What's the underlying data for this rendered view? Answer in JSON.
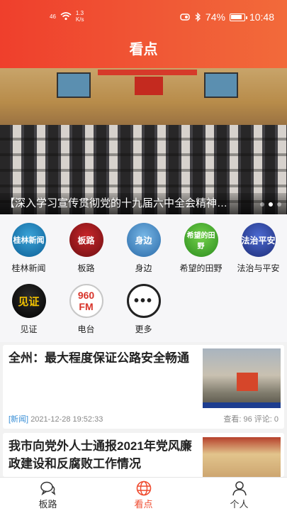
{
  "status_bar": {
    "signal": "46",
    "speed_value": "1.3",
    "speed_unit": "K/s",
    "battery": "74%",
    "time": "10:48"
  },
  "header": {
    "title": "看点"
  },
  "banner": {
    "caption": "【深入学习宣传贯彻党的十九届六中全会精神…",
    "dots": 3,
    "active_dot": 1
  },
  "channels": [
    {
      "label": "桂林新闻",
      "logo_text": "桂林新闻"
    },
    {
      "label": "板路",
      "logo_text": "板路"
    },
    {
      "label": "身边",
      "logo_text": "身边"
    },
    {
      "label": "希望的田野",
      "logo_text": "希望的田野"
    },
    {
      "label": "法治与平安",
      "logo_text": "法治平安"
    },
    {
      "label": "见证",
      "logo_text": "见证"
    },
    {
      "label": "电台",
      "logo_text": "960 FM"
    },
    {
      "label": "更多",
      "logo_text": "•••"
    }
  ],
  "news": [
    {
      "title": "全州：最大程度保证公路安全畅通",
      "tag": "[新闻]",
      "datetime": "2021-12-28 19:52:33",
      "stats": "查看: 96 评论: 0"
    },
    {
      "title": "我市向党外人士通报2021年党风廉政建设和反腐败工作情况"
    }
  ],
  "tabbar": [
    {
      "label": "板路",
      "icon": "chat-bubbles-icon"
    },
    {
      "label": "看点",
      "icon": "globe-icon",
      "active": true
    },
    {
      "label": "个人",
      "icon": "person-icon"
    }
  ],
  "colors": {
    "accent": "#ef4a2e",
    "header_start": "#ef3f2c",
    "header_end": "#f26a3a",
    "tag_blue": "#3a8fd6"
  }
}
